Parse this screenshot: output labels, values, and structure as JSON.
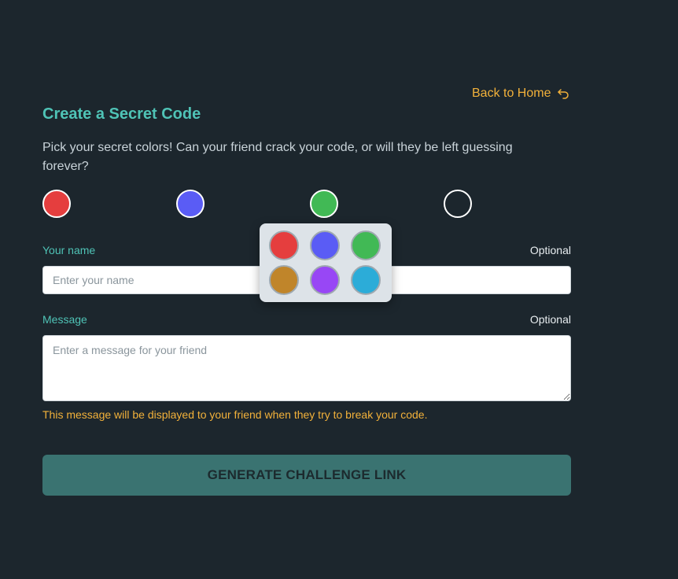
{
  "header": {
    "back_link_label": "Back to Home",
    "back_icon": "undo-arrow-icon"
  },
  "page": {
    "title": "Create a Secret Code",
    "description": "Pick your secret colors! Can your friend crack your code, or will they be left guessing forever?"
  },
  "code_slots": [
    {
      "color": "#e53e3e",
      "filled": true
    },
    {
      "color": "#5a5cf5",
      "filled": true
    },
    {
      "color": "#41b955",
      "filled": true
    },
    {
      "color": "",
      "filled": false
    }
  ],
  "color_picker": {
    "options": [
      "#e53e3e",
      "#5a5cf5",
      "#41b955",
      "#c0852a",
      "#9847f5",
      "#2cacd8"
    ]
  },
  "form": {
    "name_label": "Your name",
    "name_optional": "Optional",
    "name_placeholder": "Enter your name",
    "name_value": "",
    "message_label": "Message",
    "message_optional": "Optional",
    "message_placeholder": "Enter a message for your friend",
    "message_value": "",
    "message_hint": "This message will be displayed to your friend when they try to break your code.",
    "submit_label": "GENERATE CHALLENGE LINK"
  },
  "colors": {
    "background": "#1c262d",
    "accent_teal": "#4fc3b6",
    "accent_orange": "#f2b13a",
    "button_bg": "#3a7371"
  }
}
